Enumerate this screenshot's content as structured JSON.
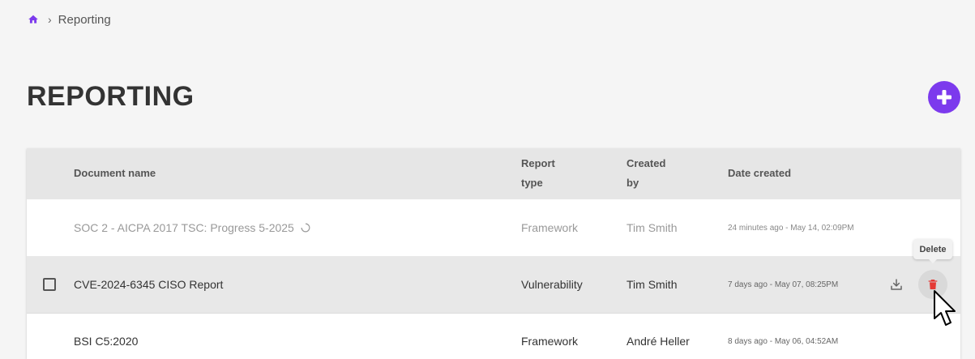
{
  "breadcrumb": {
    "current": "Reporting",
    "separator": "›"
  },
  "page": {
    "title": "REPORTING"
  },
  "colors": {
    "accent": "#7c3aed",
    "danger": "#e53935"
  },
  "icons": {
    "home": "home-icon",
    "add": "plus-icon",
    "download": "download-icon",
    "delete": "trash-icon",
    "loading": "spinner-icon",
    "cursor": "mouse-pointer-icon"
  },
  "table": {
    "headers": {
      "name": "Document name",
      "type_line1": "Report",
      "type_line2": "type",
      "created_by_line1": "Created",
      "created_by_line2": "by",
      "date": "Date created"
    },
    "rows": [
      {
        "name": "SOC 2 - AICPA 2017 TSC: Progress 5-2025",
        "type": "Framework",
        "created_by": "Tim Smith",
        "date": "24 minutes ago - May 14, 02:09PM"
      },
      {
        "name": "CVE-2024-6345 CISO Report",
        "type": "Vulnerability",
        "created_by": "Tim Smith",
        "date": "7 days ago - May 07, 08:25PM"
      },
      {
        "name": "BSI C5:2020",
        "type": "Framework",
        "created_by": "André Heller",
        "date": "8 days ago - May 06, 04:52AM"
      }
    ]
  },
  "tooltip": {
    "delete": "Delete"
  }
}
